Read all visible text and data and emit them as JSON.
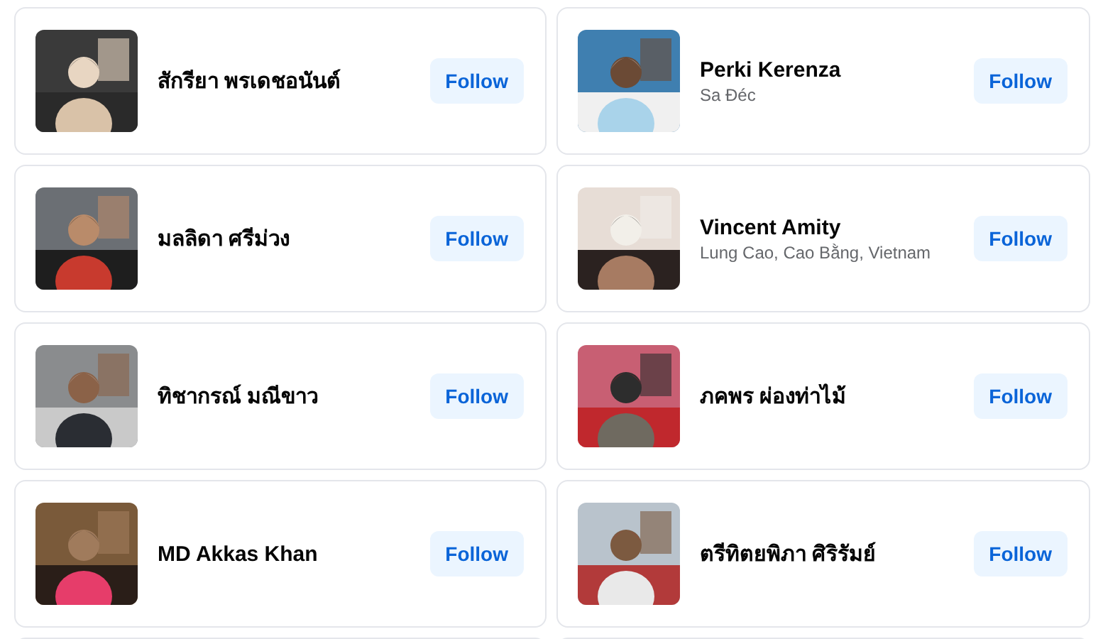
{
  "people": [
    {
      "name": "สักรียา พรเดชอนันต์",
      "button": "Follow"
    },
    {
      "name": "Perki Kerenza",
      "location": "Sa Đéc",
      "button": "Follow"
    },
    {
      "name": "มลลิดา ศรีม่วง",
      "button": "Follow"
    },
    {
      "name": "Vincent Amity",
      "location": "Lung Cao, Cao Bằng, Vietnam",
      "button": "Follow"
    },
    {
      "name": "ทิชากรณ์ มณีขาว",
      "button": "Follow"
    },
    {
      "name": "ภคพร ผ่องท่าไม้",
      "button": "Follow"
    },
    {
      "name": "MD Akkas Khan",
      "button": "Follow"
    },
    {
      "name": "ตรีทิตยพิภา ศิริรัมย์",
      "button": "Follow"
    }
  ]
}
